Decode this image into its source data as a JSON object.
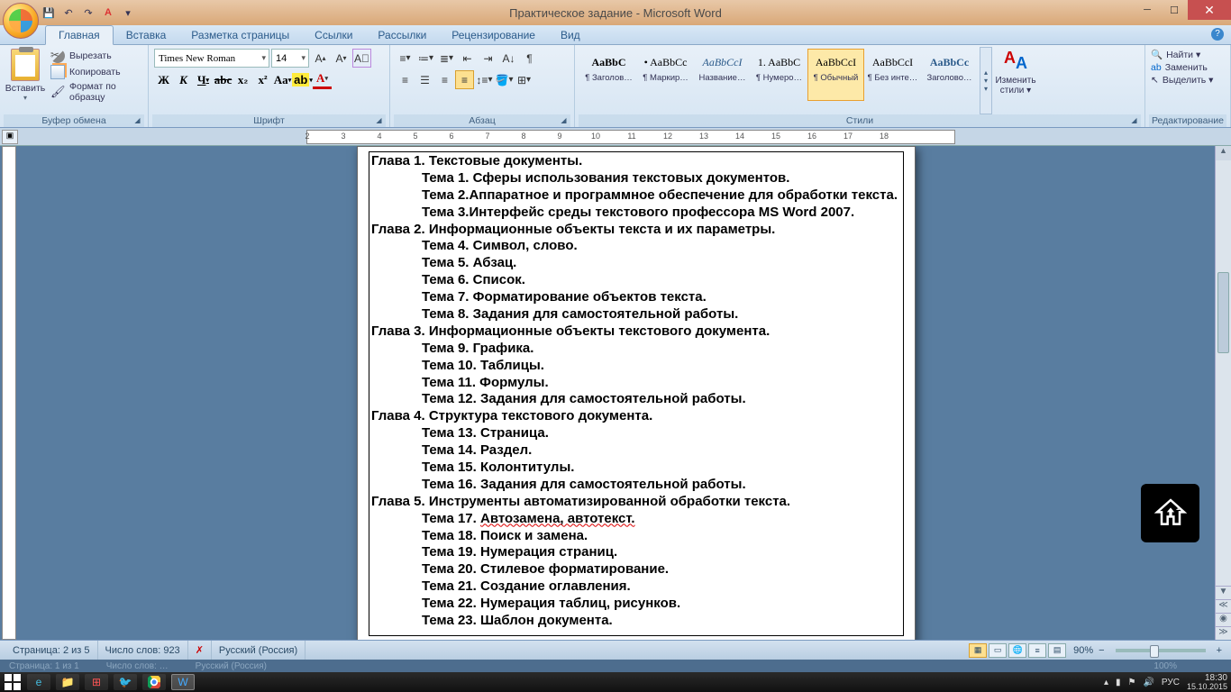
{
  "window": {
    "title": "Практическое задание - Microsoft Word"
  },
  "qat": {
    "save": "💾",
    "undo": "↶",
    "redo": "↷",
    "print": "A"
  },
  "tabs": {
    "items": [
      "Главная",
      "Вставка",
      "Разметка страницы",
      "Ссылки",
      "Рассылки",
      "Рецензирование",
      "Вид"
    ],
    "active": 0
  },
  "clipboard": {
    "paste": "Вставить",
    "cut": "Вырезать",
    "copy": "Копировать",
    "brush": "Формат по образцу",
    "label": "Буфер обмена"
  },
  "font": {
    "name": "Times New Roman",
    "size": "14",
    "label": "Шрифт"
  },
  "paragraph": {
    "label": "Абзац"
  },
  "styles": {
    "label": "Стили",
    "change": "Изменить стили ▾",
    "list": [
      {
        "prev": "AaBbC",
        "name": "¶ Заголов…",
        "bold": true
      },
      {
        "prev": "• AaBbCc",
        "name": "¶ Маркир…"
      },
      {
        "prev": "AaBbCcI",
        "name": "Название…",
        "italic": true,
        "color": "#2a5a8a"
      },
      {
        "prev": "1. AaBbC",
        "name": "¶ Нумеро…"
      },
      {
        "prev": "AaBbCcI",
        "name": "¶ Обычный",
        "sel": true
      },
      {
        "prev": "AaBbCcI",
        "name": "¶ Без инте…"
      },
      {
        "prev": "AaBbCc",
        "name": "Заголово…",
        "color": "#2a5a8a",
        "bold": true
      }
    ]
  },
  "editing": {
    "find": "Найти ▾",
    "replace": "Заменить",
    "select": "Выделить ▾",
    "label": "Редактирование"
  },
  "document": {
    "lines": [
      {
        "t": "chap",
        "text": "Глава 1. Текстовые документы."
      },
      {
        "t": "topic",
        "text": "Тема 1. Сферы использования текстовых документов."
      },
      {
        "t": "topic",
        "text": "Тема 2.Аппаратное и программное обеспечение для обработки текста."
      },
      {
        "t": "topic",
        "text": "Тема 3.Интерфейс среды текстового профессора MS Word 2007."
      },
      {
        "t": "chap",
        "text": "Глава 2. Информационные объекты текста и их параметры."
      },
      {
        "t": "topic",
        "text": "Тема 4. Символ, слово."
      },
      {
        "t": "topic",
        "text": "Тема 5. Абзац."
      },
      {
        "t": "topic",
        "text": "Тема 6. Список."
      },
      {
        "t": "topic",
        "text": "Тема 7. Форматирование объектов текста."
      },
      {
        "t": "topic",
        "text": "Тема 8. Задания для самостоятельной работы."
      },
      {
        "t": "chap",
        "text": "Глава 3. Информационные объекты текстового документа."
      },
      {
        "t": "topic",
        "text": "Тема 9. Графика."
      },
      {
        "t": "topic",
        "text": "Тема 10. Таблицы."
      },
      {
        "t": "topic",
        "text": "Тема 11. Формулы."
      },
      {
        "t": "topic",
        "text": "Тема 12.  Задания для самостоятельной работы."
      },
      {
        "t": "chap",
        "text": "Глава 4. Структура текстового документа."
      },
      {
        "t": "topic",
        "text": "Тема 13. Страница."
      },
      {
        "t": "topic",
        "text": "Тема 14. Раздел."
      },
      {
        "t": "topic",
        "text": "Тема 15. Колонтитулы."
      },
      {
        "t": "topic",
        "text": "Тема 16. Задания для самостоятельной работы."
      },
      {
        "t": "chap",
        "text": "Глава 5. Инструменты автоматизированной обработки текста."
      },
      {
        "t": "topic",
        "text": "Тема 17. ",
        "redtail": "Автозамена, автотекст."
      },
      {
        "t": "topic",
        "text": "Тема 18. Поиск и замена."
      },
      {
        "t": "topic",
        "text": "Тема 19. Нумерация страниц."
      },
      {
        "t": "topic",
        "text": "Тема 20. Стилевое форматирование."
      },
      {
        "t": "topic",
        "text": "Тема 21. Создание оглавления."
      },
      {
        "t": "topic",
        "text": "Тема 22. Нумерация таблиц, рисунков."
      },
      {
        "t": "topic",
        "text": "Тема 23. Шаблон документа."
      }
    ]
  },
  "status": {
    "page": "Страница: 2 из 5",
    "words": "Число слов: 923",
    "lang": "Русский (Россия)",
    "zoom": "90%"
  },
  "echo": {
    "page": "Страница: 1 из 1",
    "words": "Число слов: …",
    "lang": "Русский (Россия)",
    "zoom": "100%"
  },
  "tray": {
    "ime": "РУС",
    "time": "18:30",
    "date": "15.10.2015"
  },
  "ruler": {
    "start": 2,
    "end": 18
  }
}
